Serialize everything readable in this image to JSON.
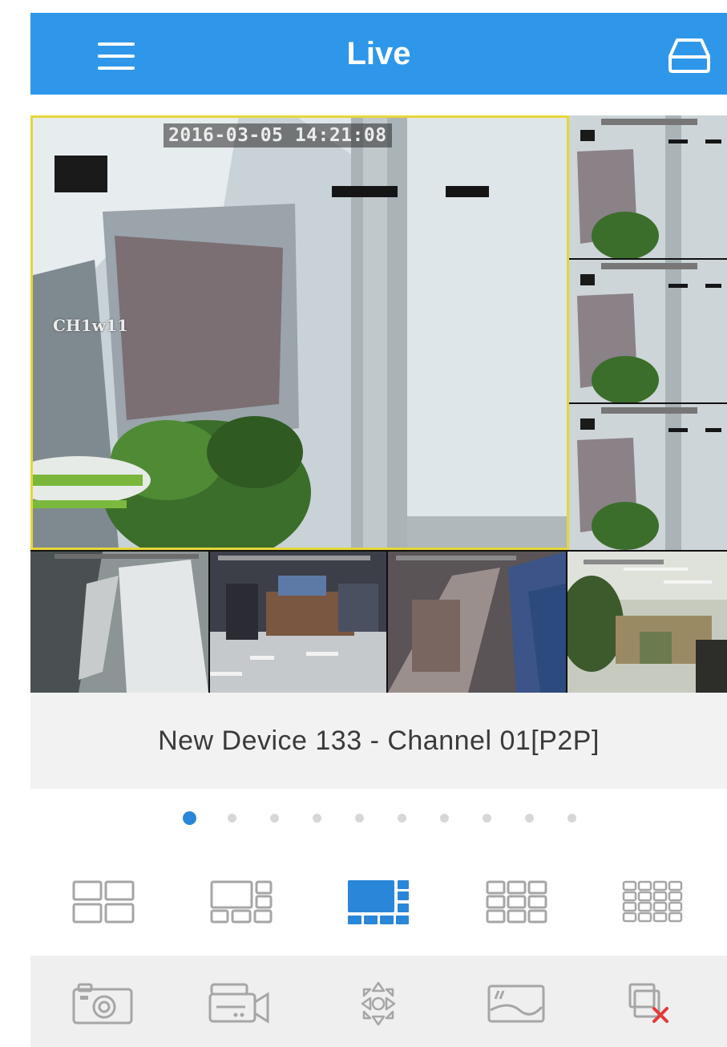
{
  "header": {
    "title": "Live",
    "menu_icon": "hamburger-menu-icon",
    "device_icon": "hard-drive-icon"
  },
  "live_view": {
    "main_tile": {
      "timestamp": "2016-03-05 14:21:08",
      "channel_label": "CH1w11"
    }
  },
  "channel_bar": {
    "name": "New Device 133 - Channel 01[P2P]"
  },
  "pagination": {
    "total_pages": 10,
    "current_page": 1
  },
  "layout_options": {
    "selected": "1+7",
    "items": [
      "4-split",
      "1+5",
      "1+7",
      "9-split",
      "16-split"
    ]
  },
  "toolbar": {
    "items": [
      "camera-snapshot-icon",
      "video-record-icon",
      "ptz-control-icon",
      "image-quality-icon",
      "close-all-icon"
    ]
  },
  "colors": {
    "header": "#2f97e9",
    "accent": "#2a86d8",
    "selected_tile_border": "#e6d63a",
    "icon_gray": "#a6a6a6"
  }
}
